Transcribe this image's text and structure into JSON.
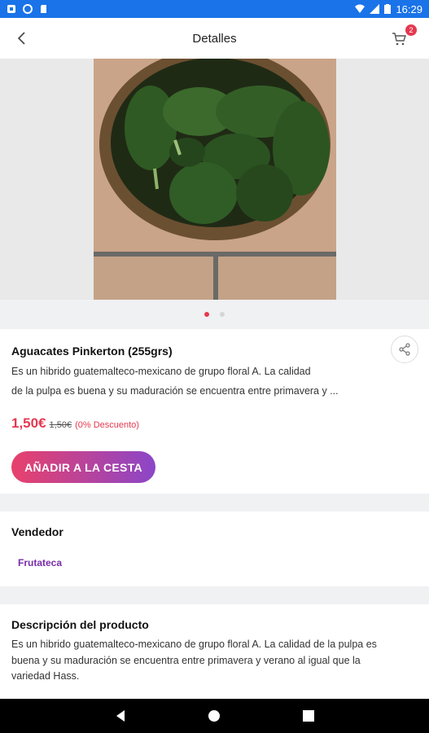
{
  "status_bar": {
    "time": "16:29"
  },
  "header": {
    "title": "Detalles",
    "cart_count": "2"
  },
  "gallery": {
    "dots": 2,
    "active_index": 0
  },
  "product": {
    "title": "Aguacates Pinkerton (255grs)",
    "desc_line1": "Es  un hibrido guatemalteco-mexicano de grupo floral A. La calidad",
    "desc_line2": "de la pulpa es buena y su maduración se encuentra entre primavera y ...",
    "price": "1,50€",
    "old_price": "1,50€",
    "discount": "(0% Descuento)",
    "add_button": "AÑADIR A LA CESTA"
  },
  "vendor": {
    "title": "Vendedor",
    "name": "Frutateca"
  },
  "description": {
    "title": "Descripción del producto",
    "body": "Es  un hibrido guatemalteco-mexicano de grupo floral A. La calidad de la pulpa es buena y su maduración se encuentra entre primavera y verano al igual que la variedad Hass."
  },
  "colors": {
    "accent": "#e53950",
    "brand_purple": "#8b46c8",
    "status_bar": "#1a73e8"
  },
  "icons": [
    "back-arrow-icon",
    "cart-icon",
    "share-icon",
    "nav-back-icon",
    "nav-home-icon",
    "nav-recents-icon"
  ]
}
